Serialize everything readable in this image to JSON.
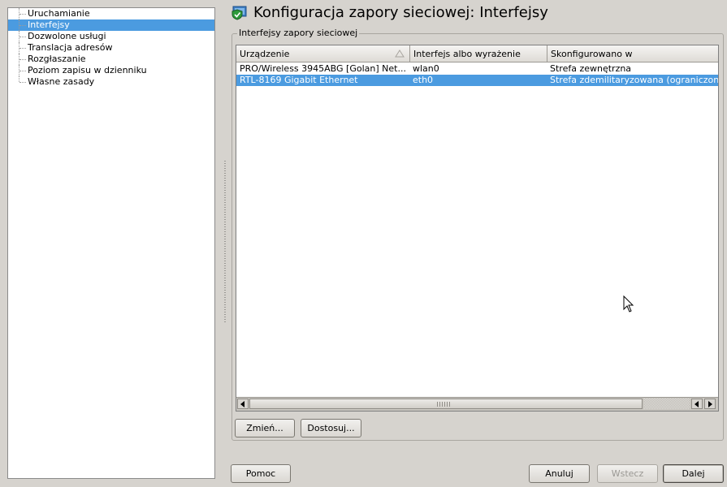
{
  "page": {
    "title": "Konfiguracja zapory sieciowej: Interfejsy",
    "icon": "firewall-shield-icon"
  },
  "sidebar": {
    "items": [
      {
        "label": "Uruchamianie",
        "selected": false
      },
      {
        "label": "Interfejsy",
        "selected": true
      },
      {
        "label": "Dozwolone usługi",
        "selected": false
      },
      {
        "label": "Translacja adresów",
        "selected": false
      },
      {
        "label": "Rozgłaszanie",
        "selected": false
      },
      {
        "label": "Poziom zapisu w dzienniku",
        "selected": false
      },
      {
        "label": "Własne zasady",
        "selected": false
      }
    ]
  },
  "group": {
    "title": "Interfejsy zapory sieciowej"
  },
  "table": {
    "columns": [
      "Urządzenie",
      "Interfejs albo wyrażenie",
      "Skonfigurowano w"
    ],
    "sorted_column": 0,
    "rows": [
      {
        "device": "PRO/Wireless 3945ABG [Golan] Net...",
        "interface": "wlan0",
        "zone": "Strefa zewnętrzna",
        "selected": false
      },
      {
        "device": "RTL-8169 Gigabit Ethernet",
        "interface": "eth0",
        "zone": "Strefa zdemilitaryzowana (ograniczone",
        "selected": true
      }
    ]
  },
  "buttons": {
    "change": "Zmień...",
    "customize": "Dostosuj...",
    "help": "Pomoc",
    "cancel": "Anuluj",
    "back": "Wstecz",
    "next": "Dalej"
  },
  "colors": {
    "selection": "#4b9be0",
    "window_bg": "#d6d3ce"
  }
}
